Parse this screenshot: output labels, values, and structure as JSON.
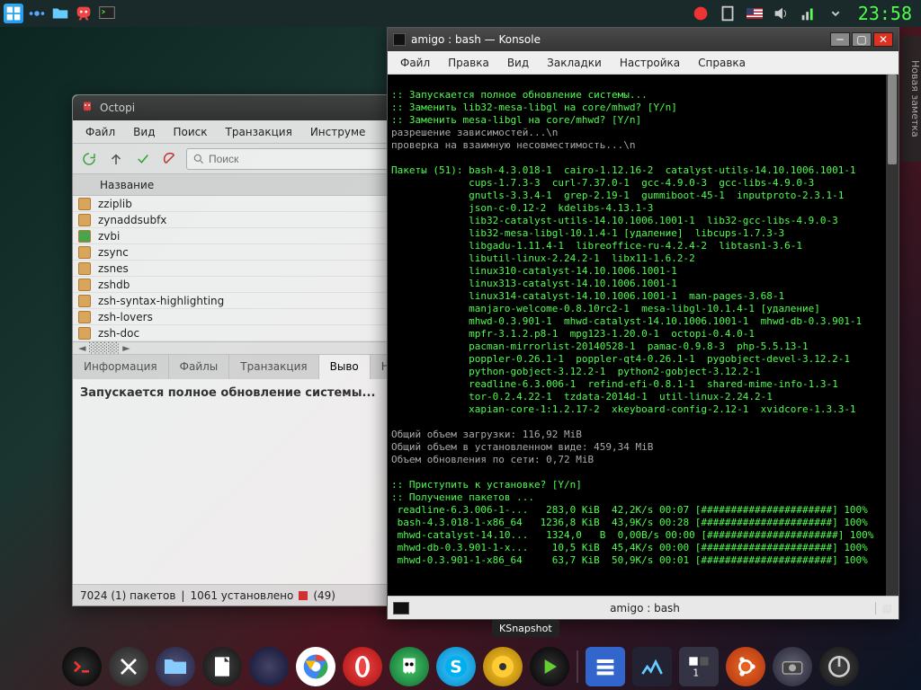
{
  "top_panel": {
    "clock": "23:58"
  },
  "right_widget": {
    "label": "Новая заметка"
  },
  "octopi": {
    "title": "Octopi",
    "menu": [
      "Файл",
      "Вид",
      "Поиск",
      "Транзакция",
      "Инструме"
    ],
    "search_placeholder": "Поиск",
    "column_header": "Название",
    "packages": [
      {
        "name": "zziplib",
        "checked": false
      },
      {
        "name": "zynaddsubfx",
        "checked": false
      },
      {
        "name": "zvbi",
        "checked": true
      },
      {
        "name": "zsync",
        "checked": false
      },
      {
        "name": "zsnes",
        "checked": false
      },
      {
        "name": "zshdb",
        "checked": false
      },
      {
        "name": "zsh-syntax-highlighting",
        "checked": false
      },
      {
        "name": "zsh-lovers",
        "checked": false
      },
      {
        "name": "zsh-doc",
        "checked": false
      }
    ],
    "tabs": [
      "Информация",
      "Файлы",
      "Транзакция",
      "Выво",
      "Новости"
    ],
    "output_line": "Запускается полное обновление системы...",
    "status_left": "7024 (1) пакетов",
    "status_mid": "1061 установлено",
    "status_badge": "(49)"
  },
  "konsole": {
    "title": "amigo : bash — Konsole",
    "menu": [
      "Файл",
      "Правка",
      "Вид",
      "Закладки",
      "Настройка",
      "Справка"
    ],
    "tab_label": "amigo : bash",
    "terminal_lines": [
      ":: Запускается полное обновление системы...",
      ":: Заменить lib32-mesa-libgl на core/mhwd? [Y/n]",
      ":: Заменить mesa-libgl на core/mhwd? [Y/n]",
      "разрешение зависимостей...\\n",
      "проверка на взаимную несовместимость...\\n",
      "",
      "Пакеты (51): bash-4.3.018-1  cairo-1.12.16-2  catalyst-utils-14.10.1006.1001-1",
      "             cups-1.7.3-3  curl-7.37.0-1  gcc-4.9.0-3  gcc-libs-4.9.0-3",
      "             gnutls-3.3.4-1  grep-2.19-1  gummiboot-45-1  inputproto-2.3.1-1",
      "             json-c-0.12-2  kdelibs-4.13.1-3",
      "             lib32-catalyst-utils-14.10.1006.1001-1  lib32-gcc-libs-4.9.0-3",
      "             lib32-mesa-libgl-10.1.4-1 [удаление]  libcups-1.7.3-3",
      "             libgadu-1.11.4-1  libreoffice-ru-4.2.4-2  libtasn1-3.6-1",
      "             libutil-linux-2.24.2-1  libx11-1.6.2-2",
      "             linux310-catalyst-14.10.1006.1001-1",
      "             linux313-catalyst-14.10.1006.1001-1",
      "             linux314-catalyst-14.10.1006.1001-1  man-pages-3.68-1",
      "             manjaro-welcome-0.8.10rc2-1  mesa-libgl-10.1.4-1 [удаление]",
      "             mhwd-0.3.901-1  mhwd-catalyst-14.10.1006.1001-1  mhwd-db-0.3.901-1",
      "             mpfr-3.1.2.p8-1  mpg123-1.20.0-1  octopi-0.4.0-1",
      "             pacman-mirrorlist-20140528-1  pamac-0.9.8-3  php-5.5.13-1",
      "             poppler-0.26.1-1  poppler-qt4-0.26.1-1  pygobject-devel-3.12.2-1",
      "             python-gobject-3.12.2-1  python2-gobject-3.12.2-1",
      "             readline-6.3.006-1  refind-efi-0.8.1-1  shared-mime-info-1.3-1",
      "             tor-0.2.4.22-1  tzdata-2014d-1  util-linux-2.24.2-1",
      "             xapian-core-1:1.2.17-2  xkeyboard-config-2.12-1  xvidcore-1.3.3-1",
      "",
      "Общий объем загрузки: 116,92 MiB",
      "Общий объем в установленном виде: 459,34 MiB",
      "Объем обновления по сети: 0,72 MiB",
      "",
      ":: Приступить к установке? [Y/n]",
      ":: Получение пакетов ...",
      " readline-6.3.006-1-...   283,0 KiB  42,2K/s 00:07 [######################] 100%",
      " bash-4.3.018-1-x86_64   1236,8 KiB  43,9K/s 00:28 [######################] 100%",
      " mhwd-catalyst-14.10...   1324,0   B  0,00B/s 00:00 [######################] 100%",
      " mhwd-db-0.3.901-1-x...    10,5 KiB  45,4K/s 00:00 [######################] 100%",
      " mhwd-0.3.901-1-x86_64     63,7 KiB  50,9K/s 00:01 [######################] 100%"
    ]
  },
  "tooltip": "KSnapshot",
  "dock": {
    "items": [
      "terminal",
      "x",
      "dolphin",
      "libreoffice",
      "moon",
      "chrome",
      "opera",
      "ghost",
      "skype",
      "media",
      "player",
      "list",
      "monitor",
      "desktop1",
      "ubuntu",
      "camera",
      "power"
    ]
  }
}
